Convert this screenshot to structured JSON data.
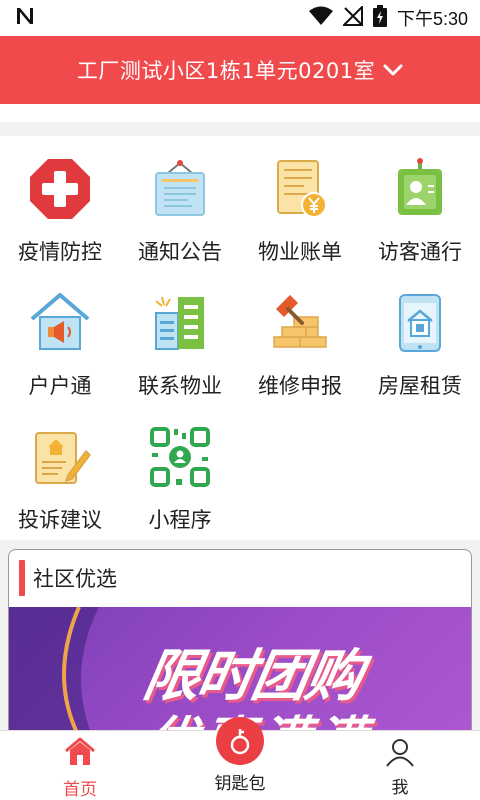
{
  "status_bar": {
    "time": "下午5:30",
    "icons": [
      "notification-n-icon",
      "wifi-icon",
      "signal-icon",
      "battery-icon"
    ]
  },
  "header": {
    "title": "工厂测试小区1栋1单元0201室",
    "background": "#f04a4d"
  },
  "services": [
    {
      "label": "疫情防控",
      "icon": "medical-cross-icon"
    },
    {
      "label": "通知公告",
      "icon": "notice-board-icon"
    },
    {
      "label": "物业账单",
      "icon": "bill-icon"
    },
    {
      "label": "访客通行",
      "icon": "visitor-pass-icon"
    },
    {
      "label": "户户通",
      "icon": "house-speaker-icon"
    },
    {
      "label": "联系物业",
      "icon": "building-icon"
    },
    {
      "label": "维修申报",
      "icon": "repair-hammer-icon"
    },
    {
      "label": "房屋租赁",
      "icon": "house-rent-icon"
    },
    {
      "label": "投诉建议",
      "icon": "complaint-pen-icon"
    },
    {
      "label": "小程序",
      "icon": "mini-program-qr-icon"
    }
  ],
  "section": {
    "title": "社区优选",
    "banner_line1": "限时团购",
    "banner_line2": "优惠满满"
  },
  "bottom_nav": {
    "home": "首页",
    "keys": "钥匙包",
    "me": "我",
    "active_color": "#f04a4d"
  }
}
